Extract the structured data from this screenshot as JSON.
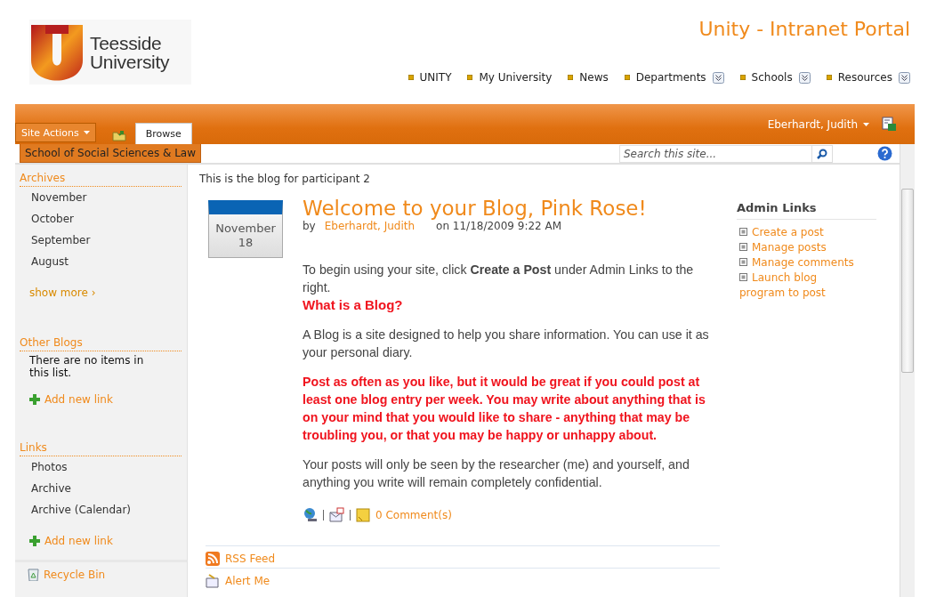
{
  "logo": {
    "lines": [
      "Teesside",
      "University"
    ]
  },
  "site_title": "Unity - Intranet Portal",
  "nav": [
    {
      "label": "UNITY",
      "dropdown": false
    },
    {
      "label": "My University",
      "dropdown": false
    },
    {
      "label": "News",
      "dropdown": false
    },
    {
      "label": "Departments",
      "dropdown": true
    },
    {
      "label": "Schools",
      "dropdown": true
    },
    {
      "label": "Resources",
      "dropdown": true
    }
  ],
  "ribbon": {
    "site_actions": "Site Actions",
    "tabs": [
      {
        "label": "Browse",
        "selected": true
      }
    ],
    "user": "Eberhardt, Judith"
  },
  "breadcrumb": "School of Social Sciences & Law",
  "search": {
    "placeholder": "Search this site..."
  },
  "sidebar": {
    "sections": [
      {
        "title": "Archives",
        "items": [
          "November",
          "October",
          "September",
          "August"
        ],
        "more": "show more ›"
      },
      {
        "title": "Other Blogs",
        "empty_text": "There are no items in this list.",
        "add_link": "Add new link"
      },
      {
        "title": "Links",
        "items": [
          "Photos",
          "Archive",
          "Archive (Calendar)"
        ],
        "add_link": "Add new link"
      }
    ],
    "recycle_bin": "Recycle Bin"
  },
  "intro": "This is the blog for participant 2",
  "post": {
    "month": "November",
    "day": "18",
    "title": "Welcome to your Blog, Pink Rose!",
    "by": "by",
    "author": "Eberhardt, Judith",
    "posted": "on 11/18/2009 9:22 AM",
    "paragraphs": [
      {
        "kind": "normal",
        "text": "To begin using your site, click **Create a Post** under Admin Links to the right."
      },
      {
        "kind": "heading",
        "text": "What is a Blog?"
      },
      {
        "kind": "normal",
        "text": "A Blog is a site designed to help you share information. You can use it as your personal diary."
      },
      {
        "kind": "alert",
        "text": "Post as often as you like, but it would be great if you could post at least one blog entry per week. You may write about anything that is on your mind that you would like to share - anything that may be troubling you, or that you may be happy or unhappy about."
      },
      {
        "kind": "normal",
        "text": "Your posts will only be seen by the researcher (me) and yourself, and anything you write will remain completely confidential."
      }
    ],
    "comments": "0 Comment(s)"
  },
  "feeds": [
    {
      "kind": "rss",
      "label": "RSS Feed"
    },
    {
      "kind": "alert",
      "label": "Alert Me"
    }
  ],
  "admin": {
    "title": "Admin Links",
    "links": [
      "Create a post",
      "Manage posts",
      "Manage comments",
      "Launch blog program to post"
    ]
  }
}
